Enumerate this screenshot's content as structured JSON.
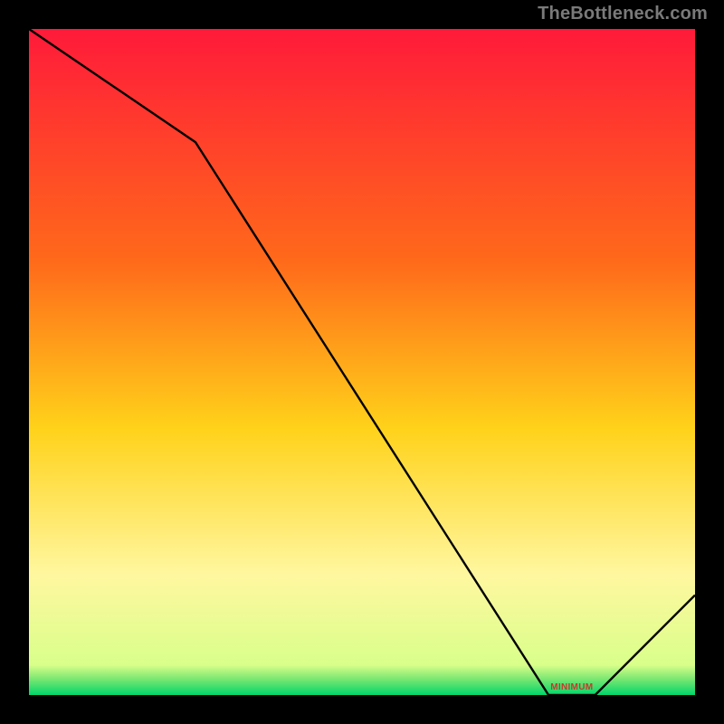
{
  "watermark": "TheBottleneck.com",
  "minimum_label": "MINIMUM",
  "colors": {
    "frame": "#000000",
    "line": "#000000",
    "watermark": "#7a7a7a",
    "min_label": "#c63a2b",
    "gradient_top": "#ff1a3a",
    "gradient_mid1": "#ff6a1a",
    "gradient_mid2": "#ffd21a",
    "gradient_mid3": "#fff7a0",
    "gradient_bottom": "#00d66b"
  },
  "chart_data": {
    "type": "line",
    "title": "",
    "xlabel": "",
    "ylabel": "",
    "xlim": [
      0,
      100
    ],
    "ylim": [
      0,
      100
    ],
    "x": [
      0,
      25,
      78,
      85,
      100
    ],
    "values": [
      100,
      83,
      0,
      0,
      15
    ],
    "minimum_region": {
      "x_start": 78,
      "x_end": 85,
      "y": 0
    },
    "gradient_stops": [
      {
        "pos": 0.0,
        "color": "#ff1a3a"
      },
      {
        "pos": 0.35,
        "color": "#ff6a1a"
      },
      {
        "pos": 0.6,
        "color": "#ffd21a"
      },
      {
        "pos": 0.82,
        "color": "#fff7a0"
      },
      {
        "pos": 0.955,
        "color": "#d9ff8a"
      },
      {
        "pos": 0.975,
        "color": "#7fe872"
      },
      {
        "pos": 1.0,
        "color": "#00d66b"
      }
    ]
  }
}
